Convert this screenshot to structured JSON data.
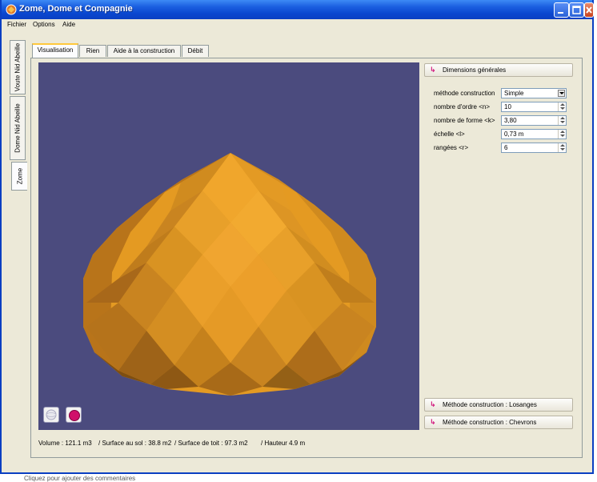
{
  "window": {
    "title": "Zome, Dome et Compagnie",
    "accent": "#0a47d0"
  },
  "menubar": {
    "items": [
      "Fichier",
      "Options",
      "Aide"
    ]
  },
  "side_tabs": [
    {
      "label": "Voute Nid Abeille",
      "active": false
    },
    {
      "label": "Dome Nid Abeille",
      "active": false
    },
    {
      "label": "Zome",
      "active": true
    }
  ],
  "top_tabs": [
    {
      "label": "Visualisation",
      "active": true
    },
    {
      "label": "Rien",
      "active": false
    },
    {
      "label": "Aide à la construction",
      "active": false
    },
    {
      "label": "Débit",
      "active": false
    }
  ],
  "viewport": {
    "background": "#4b4b7e",
    "shape_color": "#e49a22",
    "buttons": [
      {
        "icon": "sphere-outline-icon"
      },
      {
        "icon": "solid-color-dot-icon",
        "color": "#d0106a"
      }
    ]
  },
  "panel": {
    "header": "Dimensions générales",
    "fields": [
      {
        "label": "méthode construction",
        "value": "Simple",
        "kind": "combo"
      },
      {
        "label": "nombre d'ordre <n>",
        "value": "10",
        "kind": "spin"
      },
      {
        "label": "nombre de forme <k>",
        "value": "3,80",
        "kind": "spin"
      },
      {
        "label": "échelle <l>",
        "value": "0,73 m",
        "kind": "spin"
      },
      {
        "label": "rangées <r>",
        "value": "6",
        "kind": "spin"
      }
    ],
    "method_buttons": [
      "Méthode construction  : Losanges",
      "Méthode construction : Chevrons"
    ]
  },
  "stats": {
    "volume": "Volume :  121.1 m3",
    "surface_sol": "/ Surface au sol :  38.8 m2",
    "surface_toit": "/ Surface de toit :  97.3 m2",
    "hauteur": "/ Hauteur  4.9 m"
  },
  "below_text": "Cliquez pour ajouter des commentaires"
}
